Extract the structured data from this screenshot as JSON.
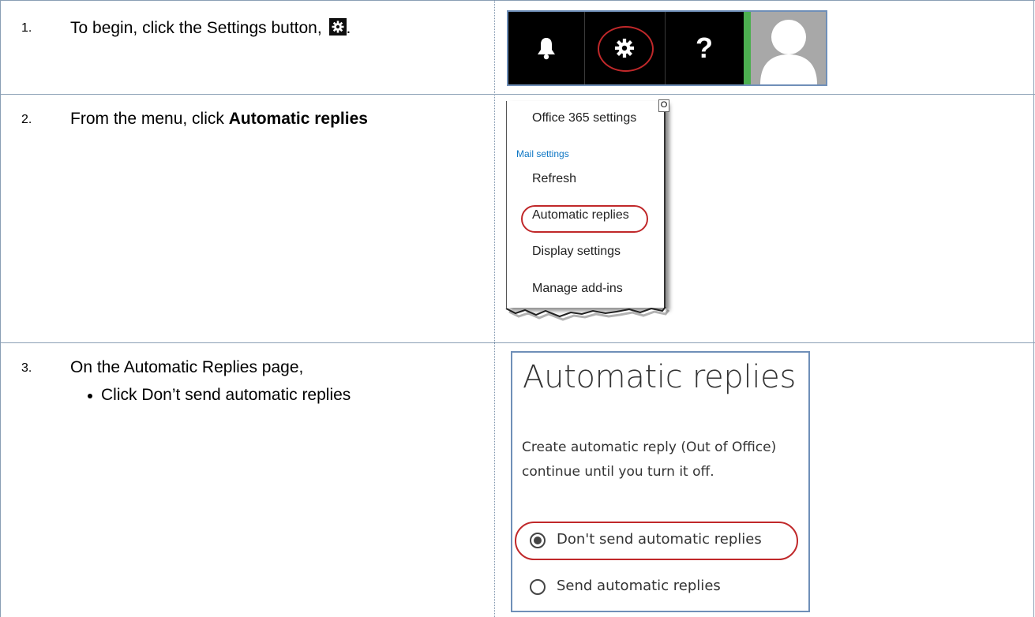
{
  "steps": [
    {
      "number": "1.",
      "text": "To begin, click the Settings button, ",
      "suffix": "."
    },
    {
      "number": "2.",
      "text_prefix": "From the menu, click ",
      "text_bold": "Automatic replies"
    },
    {
      "number": "3.",
      "text": "On the Automatic Replies page,",
      "bullets": [
        "Click Don’t send automatic replies"
      ]
    }
  ],
  "toolbar": {
    "icons": [
      "bell-icon",
      "gear-icon",
      "question-icon",
      "avatar"
    ],
    "question_glyph": "?"
  },
  "menu": {
    "corner_glyph": "O",
    "office_settings": "Office 365 settings",
    "section_header": "Mail settings",
    "items": [
      "Refresh",
      "Automatic replies",
      "Display settings",
      "Manage add-ins"
    ]
  },
  "auto_replies": {
    "title": "Automatic replies",
    "description_line1": "Create automatic reply (Out of Office)",
    "description_line2": "continue until you turn it off.",
    "options": [
      {
        "label": "Don't send automatic replies",
        "selected": true
      },
      {
        "label": "Send automatic replies",
        "selected": false
      }
    ]
  },
  "colors": {
    "highlight_ring": "#c0282a",
    "accent_green": "#4caf50",
    "link_blue": "#0d76c4",
    "border_blue": "#6f8fb8"
  }
}
